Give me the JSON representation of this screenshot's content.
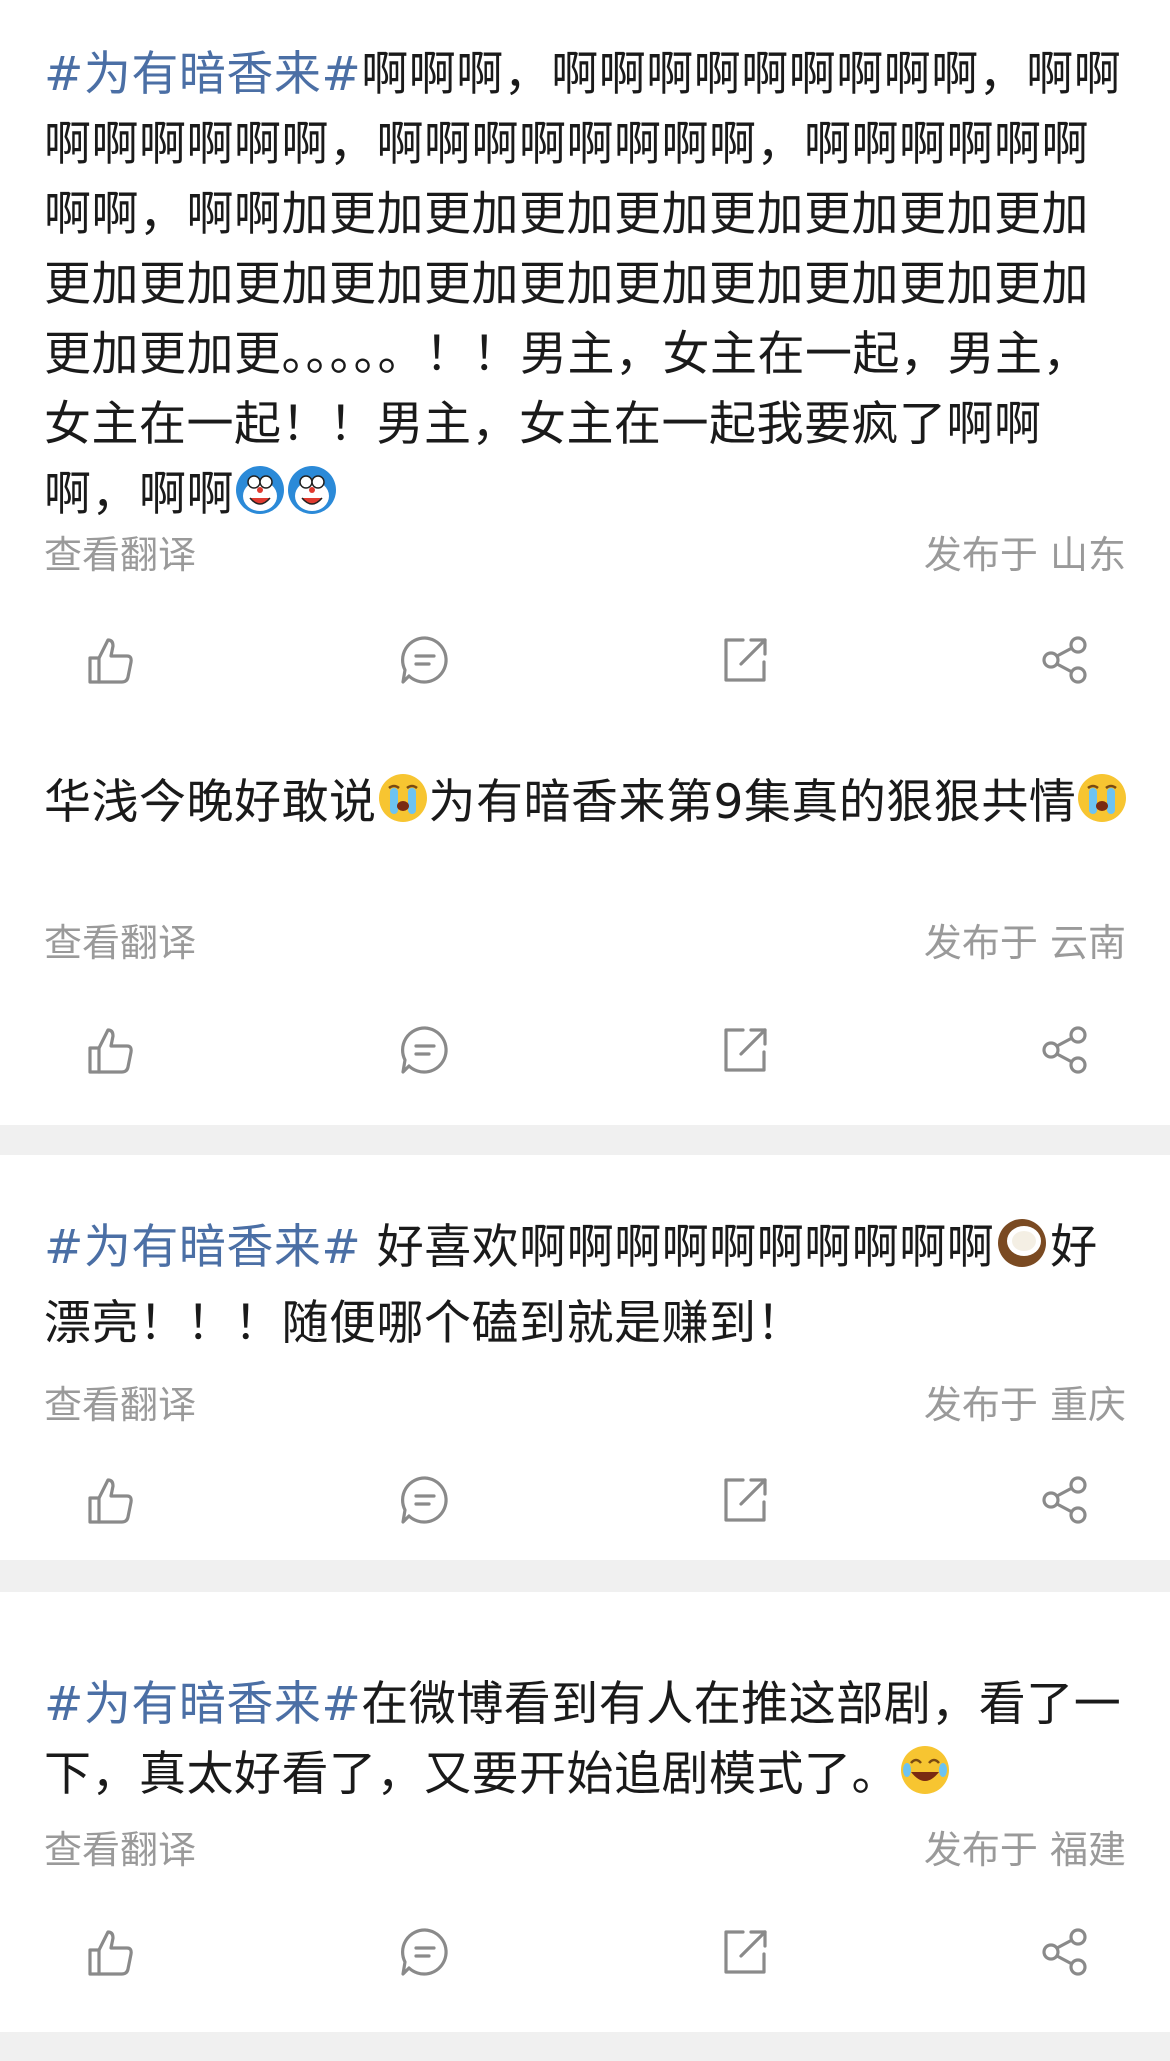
{
  "posts": [
    {
      "tag": "#为有暗香来#",
      "text": "啊啊啊，啊啊啊啊啊啊啊啊啊，啊啊啊啊啊啊啊啊，啊啊啊啊啊啊啊啊，啊啊啊啊啊啊啊啊，啊啊加更加更加更加更加更加更加更加更加更加更加更加更加更加更加更加更加更加更加更加更加更加更。。。。。！！男主，女主在一起，男主，女主在一起！！男主，女主在一起我要疯了啊啊啊，啊啊",
      "emojis": [
        "doraemon-emoji",
        "doraemon-emoji"
      ],
      "translate_label": "查看翻译",
      "location": "发布于 山东"
    },
    {
      "tag": "",
      "text": "华浅今晚好敢说",
      "text_after_emoji": "为有暗香来第9集真的狠狠共情",
      "emojis": [
        "crying-emoji",
        "crying-emoji"
      ],
      "translate_label": "查看翻译",
      "location": "发布于 云南"
    },
    {
      "tag": "#为有暗香来#",
      "text": " 好喜欢啊啊啊啊啊啊啊啊啊啊",
      "text_after_emoji": "好漂亮！！！随便哪个磕到就是赚到！",
      "emojis": [
        "coconut-emoji"
      ],
      "translate_label": "查看翻译",
      "location": "发布于 重庆"
    },
    {
      "tag": "#为有暗香来#",
      "text": "在微博看到有人在推这部剧，看了一下，真太好看了，又要开始追剧模式了。",
      "emojis": [
        "laughing-emoji"
      ],
      "translate_label": "查看翻译",
      "location": "发布于 福建"
    }
  ],
  "action_icons": [
    "like-icon",
    "comment-icon",
    "repost-icon",
    "share-icon"
  ],
  "colors": {
    "tag": "#4b6fa5",
    "text": "#1a1a1a",
    "meta": "#9a9a9a",
    "icon": "#8a8a8a",
    "divider": "#f0f0f0"
  }
}
